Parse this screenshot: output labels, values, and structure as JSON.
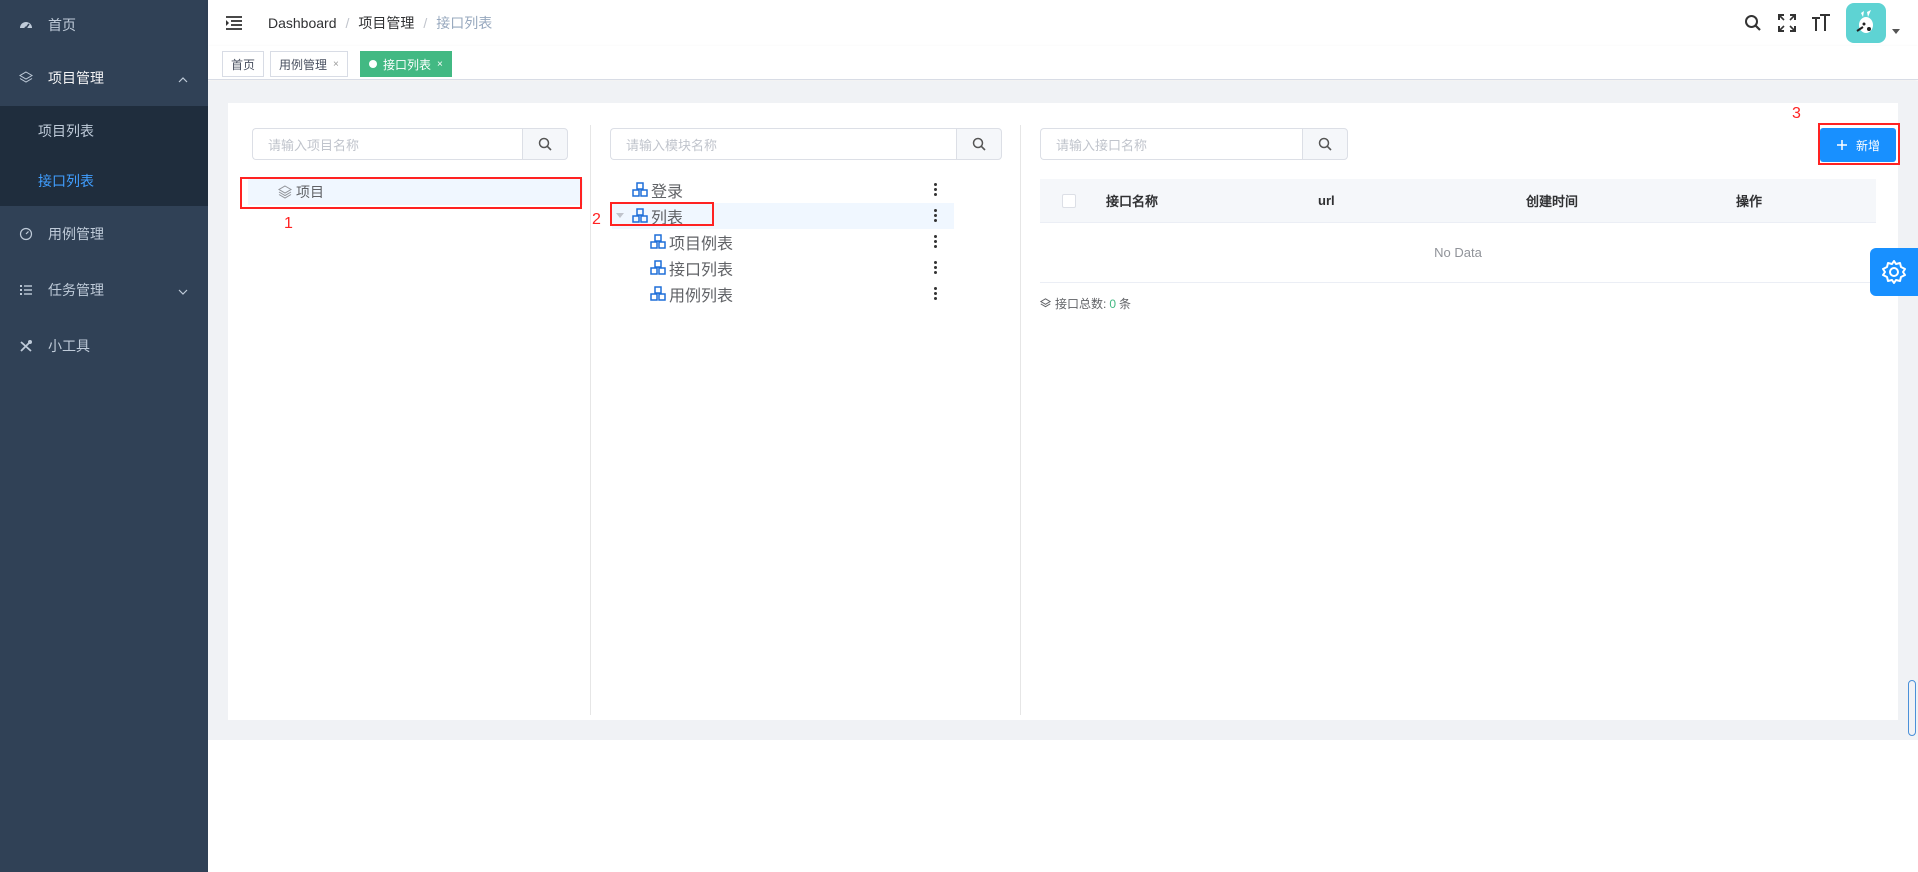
{
  "sidebar": {
    "items": [
      {
        "label": "首页",
        "icon": "dashboard-icon"
      },
      {
        "label": "项目管理",
        "icon": "layers-icon",
        "expanded": true,
        "children": [
          {
            "label": "项目列表"
          },
          {
            "label": "接口列表",
            "active": true
          }
        ]
      },
      {
        "label": "用例管理",
        "icon": "gauge-icon"
      },
      {
        "label": "任务管理",
        "icon": "task-list-icon"
      },
      {
        "label": "小工具",
        "icon": "tools-icon"
      }
    ]
  },
  "navbar": {
    "breadcrumb": [
      "Dashboard",
      "项目管理",
      "接口列表"
    ],
    "icons": [
      "search-icon",
      "fullscreen-icon",
      "font-size-icon"
    ]
  },
  "tags": [
    {
      "label": "首页"
    },
    {
      "label": "用例管理",
      "close": "×"
    },
    {
      "label": "接口列表",
      "close": "×",
      "active": true
    }
  ],
  "panels": {
    "project": {
      "search_placeholder": "请输入项目名称",
      "node": "项目"
    },
    "module": {
      "search_placeholder": "请输入模块名称",
      "nodes": [
        {
          "label": "登录"
        },
        {
          "label": "列表",
          "expanded": true
        },
        {
          "label": "项目例表"
        },
        {
          "label": "接口列表"
        },
        {
          "label": "用例列表"
        }
      ]
    },
    "api": {
      "search_placeholder": "请输入接口名称",
      "add_button": "新增",
      "columns": [
        "接口名称",
        "url",
        "创建时间",
        "操作"
      ],
      "empty_text": "No Data",
      "total_label": "接口总数:",
      "total_count": "0",
      "total_unit": "条"
    }
  },
  "annotations": [
    "1",
    "2",
    "3"
  ],
  "colors": {
    "sidebar_bg": "#304156",
    "active_menu": "#409eff",
    "tag_active": "#42b983",
    "primary": "#1890ff",
    "highlight": "#ff2222"
  }
}
